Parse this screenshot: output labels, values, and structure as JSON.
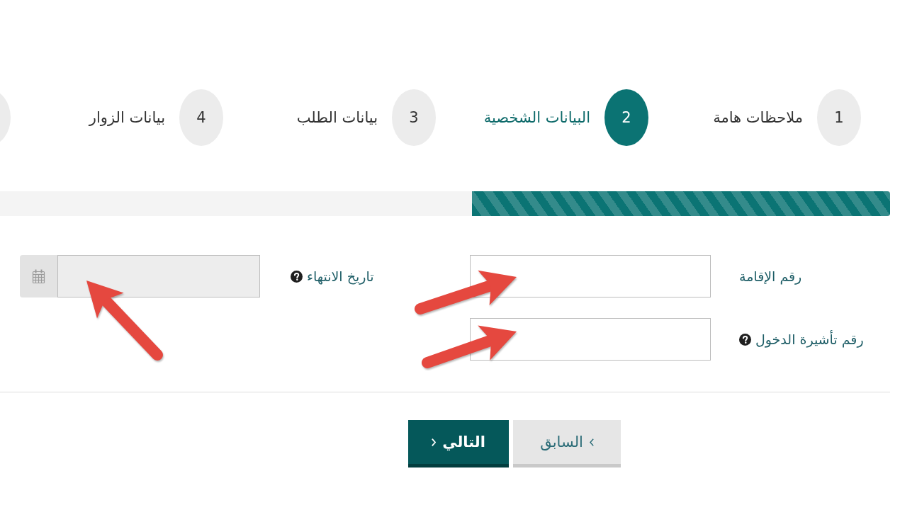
{
  "steps": [
    {
      "number": "1",
      "label": "ملاحظات هامة",
      "selected": false
    },
    {
      "number": "2",
      "label": "البيانات الشخصية",
      "selected": true
    },
    {
      "number": "3",
      "label": "بيانات الطلب",
      "selected": false
    },
    {
      "number": "4",
      "label": "بيانات الزوار",
      "selected": false
    },
    {
      "selected": false
    }
  ],
  "progress": {
    "level": 0.47
  },
  "form": {
    "columns": [
      {
        "fields": [
          {
            "label": "رقم الإقامة",
            "help": false,
            "kind": "text",
            "disabled": false
          },
          {
            "label": "رقم تأشيرة الدخول",
            "help": true,
            "kind": "text",
            "disabled": false
          }
        ]
      },
      {
        "fields": [
          {
            "label": "تاريخ الانتهاء",
            "help": true,
            "kind": "date",
            "disabled": true
          }
        ]
      }
    ]
  },
  "buttons": [
    {
      "label": "السابق",
      "kind": "previous"
    },
    {
      "label": "التالي",
      "kind": "next"
    }
  ]
}
